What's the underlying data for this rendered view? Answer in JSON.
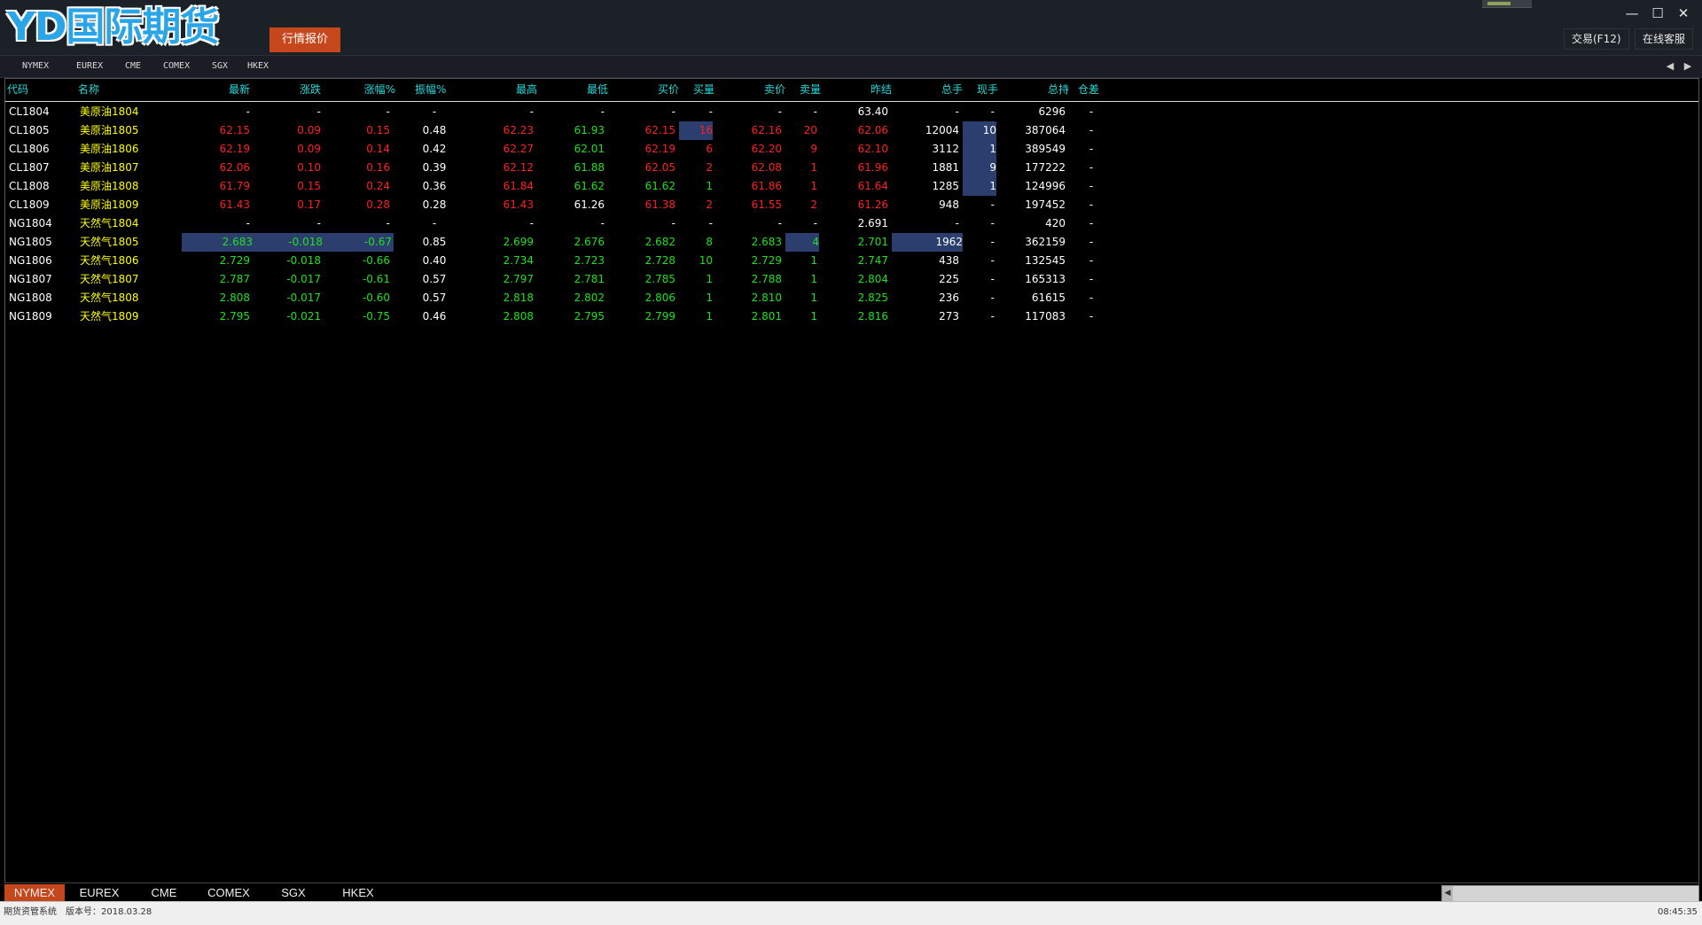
{
  "app": {
    "logo": "YD国际期货",
    "quote_button": "行情报价",
    "trade_button": "交易(F12)",
    "service_button": "在线客服"
  },
  "exchanges": [
    "NYMEX",
    "EUREX",
    "CME",
    "COMEX",
    "SGX",
    "HKEX"
  ],
  "columns": [
    "代码",
    "名称",
    "最新",
    "涨跌",
    "涨幅%",
    "振幅%",
    "最高",
    "最低",
    "买价",
    "买量",
    "卖价",
    "卖量",
    "昨结",
    "总手",
    "现手",
    "总持",
    "仓差"
  ],
  "rows": [
    [
      "CL1804",
      "美原油1804",
      "-",
      "-",
      "-",
      "-",
      "-",
      "-",
      "-",
      "-",
      "-",
      "-",
      "63.40",
      "-",
      "-",
      "6296",
      "-"
    ],
    [
      "CL1805",
      "美原油1805",
      "62.15",
      "0.09",
      "0.15",
      "0.48",
      "62.23",
      "61.93",
      "62.15",
      "16",
      "62.16",
      "20",
      "62.06",
      "12004",
      "10",
      "387064",
      "-"
    ],
    [
      "CL1806",
      "美原油1806",
      "62.19",
      "0.09",
      "0.14",
      "0.42",
      "62.27",
      "62.01",
      "62.19",
      "6",
      "62.20",
      "9",
      "62.10",
      "3112",
      "1",
      "389549",
      "-"
    ],
    [
      "CL1807",
      "美原油1807",
      "62.06",
      "0.10",
      "0.16",
      "0.39",
      "62.12",
      "61.88",
      "62.05",
      "2",
      "62.08",
      "1",
      "61.96",
      "1881",
      "9",
      "177222",
      "-"
    ],
    [
      "CL1808",
      "美原油1808",
      "61.79",
      "0.15",
      "0.24",
      "0.36",
      "61.84",
      "61.62",
      "61.62",
      "1",
      "61.86",
      "1",
      "61.64",
      "1285",
      "1",
      "124996",
      "-"
    ],
    [
      "CL1809",
      "美原油1809",
      "61.43",
      "0.17",
      "0.28",
      "0.28",
      "61.43",
      "61.26",
      "61.38",
      "2",
      "61.55",
      "2",
      "61.26",
      "948",
      "-",
      "197452",
      "-"
    ],
    [
      "NG1804",
      "天然气1804",
      "-",
      "-",
      "-",
      "-",
      "-",
      "-",
      "-",
      "-",
      "-",
      "-",
      "2.691",
      "-",
      "-",
      "420",
      "-"
    ],
    [
      "NG1805",
      "天然气1805",
      "2.683",
      "-0.018",
      "-0.67",
      "0.85",
      "2.699",
      "2.676",
      "2.682",
      "8",
      "2.683",
      "4",
      "2.701",
      "1962",
      "-",
      "362159",
      "-"
    ],
    [
      "NG1806",
      "天然气1806",
      "2.729",
      "-0.018",
      "-0.66",
      "0.40",
      "2.734",
      "2.723",
      "2.728",
      "10",
      "2.729",
      "1",
      "2.747",
      "438",
      "-",
      "132545",
      "-"
    ],
    [
      "NG1807",
      "天然气1807",
      "2.787",
      "-0.017",
      "-0.61",
      "0.57",
      "2.797",
      "2.781",
      "2.785",
      "1",
      "2.788",
      "1",
      "2.804",
      "225",
      "-",
      "165313",
      "-"
    ],
    [
      "NG1808",
      "天然气1808",
      "2.808",
      "-0.017",
      "-0.60",
      "0.57",
      "2.818",
      "2.802",
      "2.806",
      "1",
      "2.810",
      "1",
      "2.825",
      "236",
      "-",
      "61615",
      "-"
    ],
    [
      "NG1809",
      "天然气1809",
      "2.795",
      "-0.021",
      "-0.75",
      "0.46",
      "2.808",
      "2.795",
      "2.799",
      "1",
      "2.801",
      "1",
      "2.816",
      "273",
      "-",
      "117083",
      "-"
    ]
  ],
  "status": {
    "system": "期货资管系统",
    "version": "版本号：2018.03.28",
    "time": "08:45:35"
  },
  "colors": {
    "accent": "#c6471b",
    "up": "#ff2020",
    "down": "#20e020",
    "name": "#ffff00",
    "header": "#28d8d8",
    "highlight": "#2c3e6e"
  },
  "icons": [
    "minimize-icon",
    "maximize-icon",
    "close-icon",
    "arrow-left-icon",
    "arrow-right-icon"
  ]
}
